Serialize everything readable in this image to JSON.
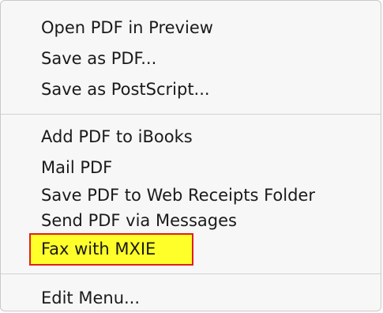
{
  "menu": {
    "group1": [
      {
        "label": "Open PDF in Preview"
      },
      {
        "label": "Save as PDF..."
      },
      {
        "label": "Save as PostScript..."
      }
    ],
    "group2": [
      {
        "label": "Add PDF to iBooks"
      },
      {
        "label": "Mail PDF"
      },
      {
        "label": "Save PDF to Web Receipts Folder"
      },
      {
        "label": "Send PDF via Messages"
      },
      {
        "label": "Fax with MXIE"
      }
    ],
    "group3": [
      {
        "label": "Edit Menu..."
      }
    ]
  },
  "colors": {
    "highlight_fill": "#ffff2a",
    "highlight_border": "#e02020"
  }
}
